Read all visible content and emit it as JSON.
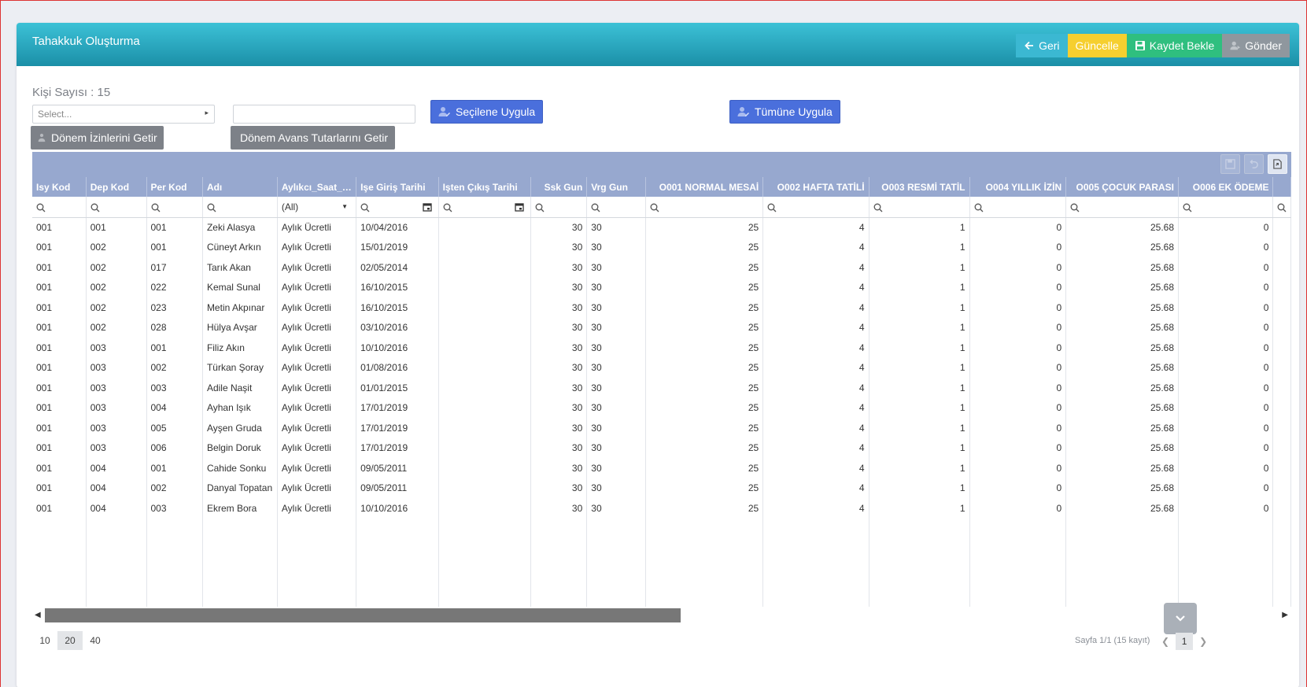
{
  "header": {
    "title": "Tahakkuk Oluşturma",
    "buttons": {
      "back": "Geri",
      "update": "Güncelle",
      "save_wait": "Kaydet Bekle",
      "send": "Gönder"
    }
  },
  "form": {
    "person_count_label": "Kişi Sayısı : 15",
    "select_placeholder": "Select...",
    "text_value": "",
    "apply_selected": "Seçilene Uygula",
    "apply_all": "Tümüne Uygula",
    "get_leaves": "Dönem İzinlerini Getir",
    "get_advances": "Dönem Avans Tutarlarını Getir"
  },
  "grid": {
    "columns": [
      "Isy Kod",
      "Dep Kod",
      "Per Kod",
      "Adı",
      "Aylıkcı_Saat_ü...",
      "Işe Giriş Tarihi",
      "Işten Çıkış Tarihi",
      "Ssk Gun",
      "Vrg Gun",
      "O001 NORMAL MESAİ",
      "O002 HAFTA TATİLİ",
      "O003 RESMİ TATİL",
      "O004 YILLIK İZİN",
      "O005 ÇOCUK PARASI",
      "O006 EK ÖDEME"
    ],
    "filter_all": "(All)",
    "rows": [
      [
        "001",
        "001",
        "001",
        "Zeki Alasya",
        "Aylık Ücretli",
        "10/04/2016",
        "",
        "30",
        "30",
        "25",
        "4",
        "1",
        "0",
        "25.68",
        "0"
      ],
      [
        "001",
        "002",
        "001",
        "Cüneyt Arkın",
        "Aylık Ücretli",
        "15/01/2019",
        "",
        "30",
        "30",
        "25",
        "4",
        "1",
        "0",
        "25.68",
        "0"
      ],
      [
        "001",
        "002",
        "017",
        "Tarık Akan",
        "Aylık Ücretli",
        "02/05/2014",
        "",
        "30",
        "30",
        "25",
        "4",
        "1",
        "0",
        "25.68",
        "0"
      ],
      [
        "001",
        "002",
        "022",
        "Kemal Sunal",
        "Aylık Ücretli",
        "16/10/2015",
        "",
        "30",
        "30",
        "25",
        "4",
        "1",
        "0",
        "25.68",
        "0"
      ],
      [
        "001",
        "002",
        "023",
        "Metin Akpınar",
        "Aylık Ücretli",
        "16/10/2015",
        "",
        "30",
        "30",
        "25",
        "4",
        "1",
        "0",
        "25.68",
        "0"
      ],
      [
        "001",
        "002",
        "028",
        "Hülya Avşar",
        "Aylık Ücretli",
        "03/10/2016",
        "",
        "30",
        "30",
        "25",
        "4",
        "1",
        "0",
        "25.68",
        "0"
      ],
      [
        "001",
        "003",
        "001",
        "Filiz Akın",
        "Aylık Ücretli",
        "10/10/2016",
        "",
        "30",
        "30",
        "25",
        "4",
        "1",
        "0",
        "25.68",
        "0"
      ],
      [
        "001",
        "003",
        "002",
        "Türkan Şoray",
        "Aylık Ücretli",
        "01/08/2016",
        "",
        "30",
        "30",
        "25",
        "4",
        "1",
        "0",
        "25.68",
        "0"
      ],
      [
        "001",
        "003",
        "003",
        "Adile Naşit",
        "Aylık Ücretli",
        "01/01/2015",
        "",
        "30",
        "30",
        "25",
        "4",
        "1",
        "0",
        "25.68",
        "0"
      ],
      [
        "001",
        "003",
        "004",
        "Ayhan Işık",
        "Aylık Ücretli",
        "17/01/2019",
        "",
        "30",
        "30",
        "25",
        "4",
        "1",
        "0",
        "25.68",
        "0"
      ],
      [
        "001",
        "003",
        "005",
        "Ayşen Gruda",
        "Aylık Ücretli",
        "17/01/2019",
        "",
        "30",
        "30",
        "25",
        "4",
        "1",
        "0",
        "25.68",
        "0"
      ],
      [
        "001",
        "003",
        "006",
        "Belgin Doruk",
        "Aylık Ücretli",
        "17/01/2019",
        "",
        "30",
        "30",
        "25",
        "4",
        "1",
        "0",
        "25.68",
        "0"
      ],
      [
        "001",
        "004",
        "001",
        "Cahide Sonku",
        "Aylık Ücretli",
        "09/05/2011",
        "",
        "30",
        "30",
        "25",
        "4",
        "1",
        "0",
        "25.68",
        "0"
      ],
      [
        "001",
        "004",
        "002",
        "Danyal Topatan",
        "Aylık Ücretli",
        "09/05/2011",
        "",
        "30",
        "30",
        "25",
        "4",
        "1",
        "0",
        "25.68",
        "0"
      ],
      [
        "001",
        "004",
        "003",
        "Ekrem Bora",
        "Aylık Ücretli",
        "10/10/2016",
        "",
        "30",
        "30",
        "25",
        "4",
        "1",
        "0",
        "25.68",
        "0"
      ]
    ]
  },
  "pager": {
    "sizes": [
      "10",
      "20",
      "40"
    ],
    "selected_size": "20",
    "info": "Sayfa 1/1 (15 kayıt)",
    "current_page": "1"
  }
}
